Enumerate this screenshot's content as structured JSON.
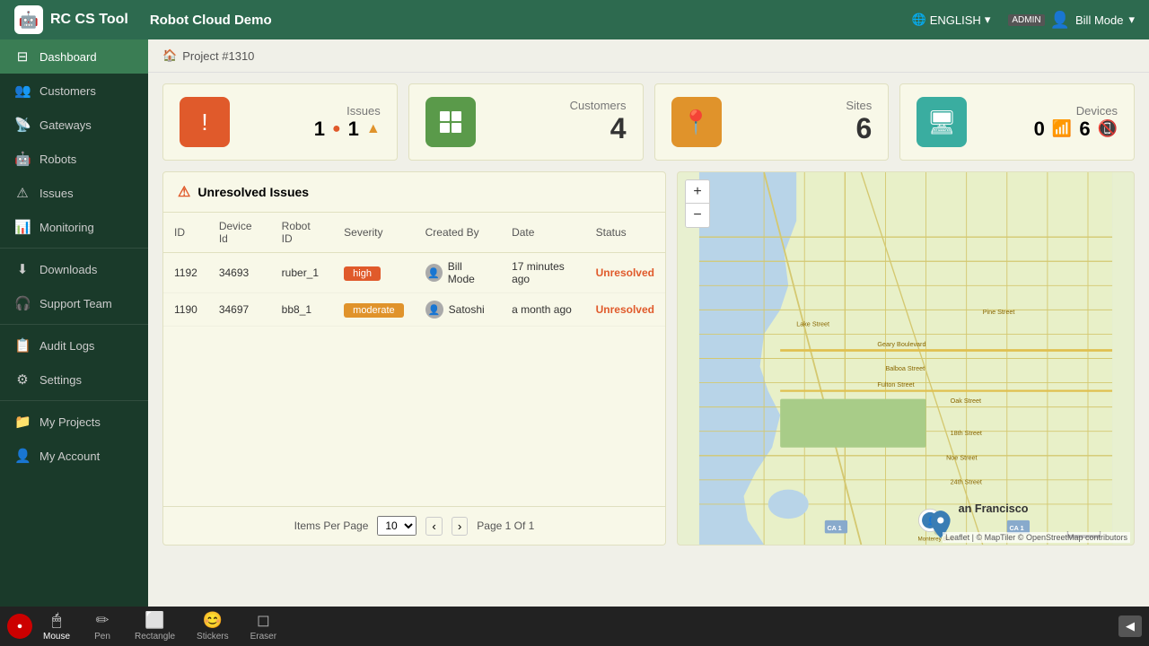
{
  "app": {
    "title": "RC CS Tool",
    "project": "Robot Cloud Demo",
    "lang": "ENGLISH",
    "user_role": "ADMIN",
    "user_name": "Bill Mode"
  },
  "breadcrumb": {
    "home_icon": "🏠",
    "project": "Project #1310"
  },
  "summary_cards": [
    {
      "id": "issues",
      "label": "Issues",
      "value": "",
      "sub_items": [
        "1",
        "1"
      ],
      "icon": "!",
      "color": "red"
    },
    {
      "id": "customers",
      "label": "Customers",
      "value": "4",
      "icon": "⊞",
      "color": "green"
    },
    {
      "id": "sites",
      "label": "Sites",
      "value": "6",
      "icon": "📍",
      "color": "orange"
    },
    {
      "id": "devices",
      "label": "Devices",
      "value_left": "0",
      "value_right": "6",
      "icon": "🖥",
      "color": "teal"
    }
  ],
  "issues_panel": {
    "title": "Unresolved Issues",
    "columns": [
      "ID",
      "Device Id",
      "Robot ID",
      "Severity",
      "Created By",
      "Date",
      "Status"
    ],
    "rows": [
      {
        "id": "1192",
        "device_id": "34693",
        "robot_id": "ruber_1",
        "severity": "high",
        "created_by": "Bill Mode",
        "date": "17 minutes ago",
        "status": "Unresolved"
      },
      {
        "id": "1190",
        "device_id": "34697",
        "robot_id": "bb8_1",
        "severity": "moderate",
        "created_by": "Satoshi",
        "date": "a month ago",
        "status": "Unresolved"
      }
    ],
    "pagination": {
      "items_per_page_label": "Items Per Page",
      "items_per_page_value": "10",
      "page_label": "Page 1 Of 1"
    }
  },
  "map": {
    "attribution": "Leaflet | © MapTiler © OpenStreetMap contributors"
  },
  "sidebar": {
    "items": [
      {
        "id": "dashboard",
        "label": "Dashboard",
        "icon": "⊟",
        "active": true
      },
      {
        "id": "customers",
        "label": "Customers",
        "icon": "👥",
        "active": false
      },
      {
        "id": "gateways",
        "label": "Gateways",
        "icon": "📡",
        "active": false
      },
      {
        "id": "robots",
        "label": "Robots",
        "icon": "🤖",
        "active": false
      },
      {
        "id": "issues",
        "label": "Issues",
        "icon": "⚠",
        "active": false
      },
      {
        "id": "monitoring",
        "label": "Monitoring",
        "icon": "📊",
        "active": false
      },
      {
        "id": "downloads",
        "label": "Downloads",
        "icon": "⬇",
        "active": false
      },
      {
        "id": "support-team",
        "label": "Support Team",
        "icon": "🎧",
        "active": false
      },
      {
        "id": "audit-logs",
        "label": "Audit Logs",
        "icon": "📋",
        "active": false
      },
      {
        "id": "settings",
        "label": "Settings",
        "icon": "⚙",
        "active": false
      },
      {
        "id": "my-projects",
        "label": "My Projects",
        "icon": "📁",
        "active": false
      },
      {
        "id": "my-account",
        "label": "My Account",
        "icon": "👤",
        "active": false
      }
    ]
  },
  "toolbar": {
    "tools": [
      {
        "id": "record",
        "icon": "⏺",
        "label": ""
      },
      {
        "id": "mouse",
        "icon": "🖱",
        "label": "Mouse"
      },
      {
        "id": "pen",
        "icon": "✏",
        "label": "Pen"
      },
      {
        "id": "rectangle",
        "icon": "⬜",
        "label": "Rectangle"
      },
      {
        "id": "stickers",
        "icon": "😊",
        "label": "Stickers"
      },
      {
        "id": "eraser",
        "icon": "◻",
        "label": "Eraser"
      }
    ],
    "collapse_icon": "◀"
  }
}
